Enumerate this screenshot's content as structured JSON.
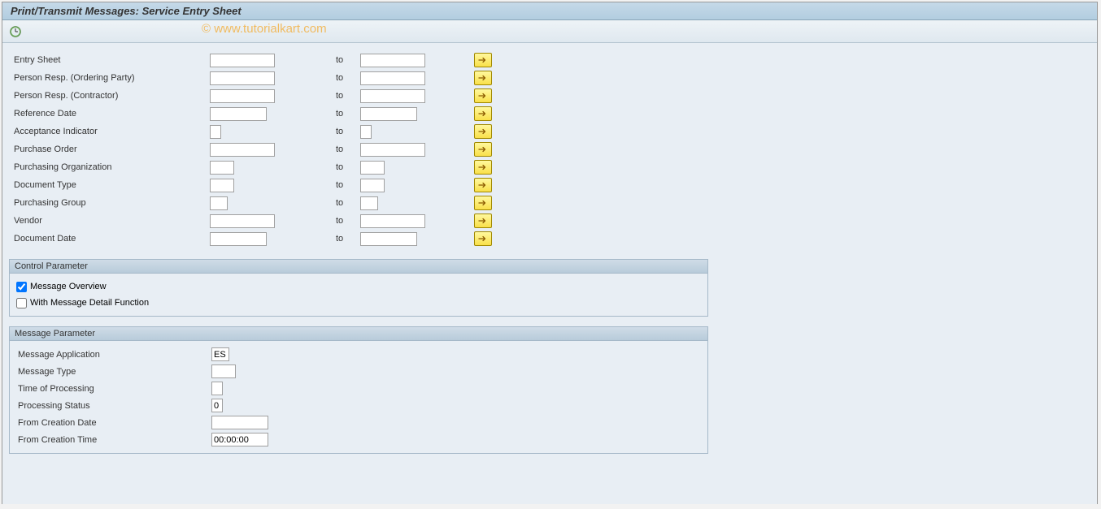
{
  "header": {
    "title": "Print/Transmit Messages: Service Entry Sheet",
    "watermark": "© www.tutorialkart.com"
  },
  "selection": {
    "to_label": "to",
    "rows": [
      {
        "label": "Entry Sheet",
        "w": "80"
      },
      {
        "label": "Person Resp. (Ordering Party)",
        "w": "80"
      },
      {
        "label": "Person Resp. (Contractor)",
        "w": "80"
      },
      {
        "label": "Reference Date",
        "w": "70"
      },
      {
        "label": "Acceptance Indicator",
        "w": "14"
      },
      {
        "label": "Purchase Order",
        "w": "80"
      },
      {
        "label": "Purchasing Organization",
        "w": "30"
      },
      {
        "label": "Document Type",
        "w": "30"
      },
      {
        "label": "Purchasing Group",
        "w": "22"
      },
      {
        "label": "Vendor",
        "w": "80"
      },
      {
        "label": "Document Date",
        "w": "70"
      }
    ]
  },
  "groups": {
    "control": {
      "title": "Control Parameter",
      "message_overview": {
        "label": "Message Overview",
        "checked": true
      },
      "with_detail": {
        "label": "With Message Detail Function",
        "checked": false
      }
    },
    "message": {
      "title": "Message Parameter",
      "rows": [
        {
          "label": "Message Application",
          "value": "ES",
          "w": "22"
        },
        {
          "label": "Message Type",
          "value": "",
          "w": "30"
        },
        {
          "label": "Time of Processing",
          "value": "",
          "w": "14"
        },
        {
          "label": "Processing Status",
          "value": "0",
          "w": "14"
        },
        {
          "label": "From Creation Date",
          "value": "",
          "w": "70"
        },
        {
          "label": "From Creation Time",
          "value": "00:00:00",
          "w": "70"
        }
      ]
    }
  }
}
